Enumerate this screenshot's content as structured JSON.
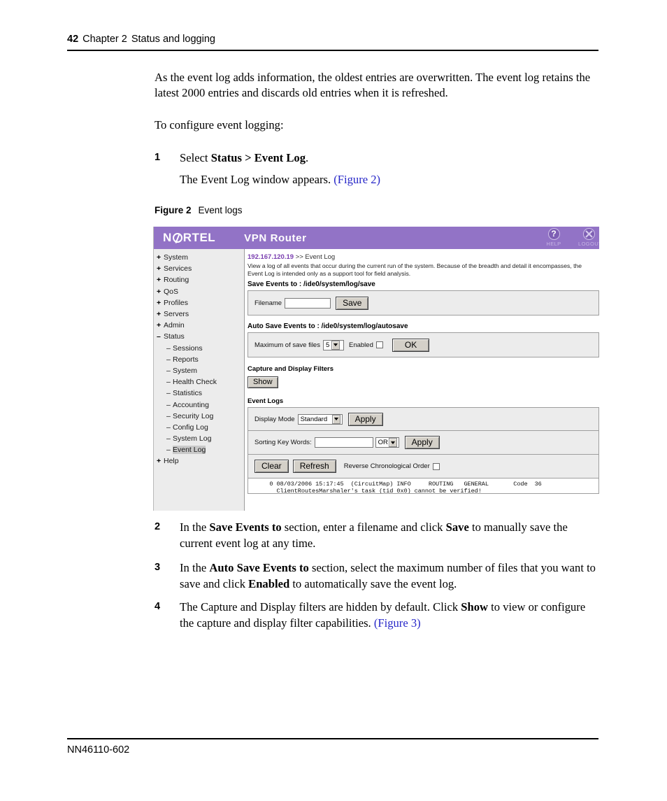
{
  "page": {
    "number": "42",
    "chapter": "Chapter 2",
    "chapter_title": "Status and logging",
    "footer_doc_id": "NN46110-602"
  },
  "paragraphs": {
    "p1": "As the event log adds information, the oldest entries are overwritten. The event log retains the latest 2000 entries and discards old entries when it is refreshed.",
    "p2": "To configure event logging:"
  },
  "steps": [
    {
      "num": "1",
      "text_pre": "Select ",
      "bold": "Status > Event Log",
      "text_post": ".",
      "subtext_pre": "The Event Log window appears. ",
      "sublink": "(Figure 2)"
    },
    {
      "num": "2",
      "text_pre": "In the ",
      "bold": "Save Events to",
      "text_mid": " section, enter a filename and click ",
      "bold2": "Save",
      "text_post": " to manually save the current event log at any time."
    },
    {
      "num": "3",
      "text_pre": "In the ",
      "bold": "Auto Save Events to",
      "text_mid": " section, select the maximum number of files that you want to save and click ",
      "bold2": "Enabled",
      "text_post": " to automatically save the event log."
    },
    {
      "num": "4",
      "text_pre": "The Capture and Display filters are hidden by default. Click ",
      "bold": "Show",
      "text_post": " to view or configure the capture and display filter capabilities. ",
      "link": "(Figure 3)"
    }
  ],
  "figure": {
    "label": "Figure 2",
    "caption": "Event logs"
  },
  "screenshot": {
    "brand": "N",
    "brand_rest": "RTEL",
    "title": "VPN  Router",
    "top_icons": [
      {
        "glyph": "?",
        "caption": "HELP"
      },
      {
        "glyph": "",
        "caption": "LOGOUT"
      }
    ],
    "sidebar": [
      {
        "level": 1,
        "sign": "+",
        "label": "System",
        "selected": false
      },
      {
        "level": 1,
        "sign": "+",
        "label": "Services",
        "selected": false
      },
      {
        "level": 1,
        "sign": "+",
        "label": "Routing",
        "selected": false
      },
      {
        "level": 1,
        "sign": "+",
        "label": "QoS",
        "selected": false
      },
      {
        "level": 1,
        "sign": "+",
        "label": "Profiles",
        "selected": false
      },
      {
        "level": 1,
        "sign": "+",
        "label": "Servers",
        "selected": false
      },
      {
        "level": 1,
        "sign": "+",
        "label": "Admin",
        "selected": false
      },
      {
        "level": 1,
        "sign": "–",
        "label": "Status",
        "selected": false
      },
      {
        "level": 2,
        "sign": "–",
        "label": "Sessions",
        "selected": false
      },
      {
        "level": 2,
        "sign": "–",
        "label": "Reports",
        "selected": false
      },
      {
        "level": 2,
        "sign": "–",
        "label": "System",
        "selected": false
      },
      {
        "level": 2,
        "sign": "–",
        "label": "Health Check",
        "selected": false
      },
      {
        "level": 2,
        "sign": "–",
        "label": "Statistics",
        "selected": false
      },
      {
        "level": 2,
        "sign": "–",
        "label": "Accounting",
        "selected": false
      },
      {
        "level": 2,
        "sign": "–",
        "label": "Security Log",
        "selected": false
      },
      {
        "level": 2,
        "sign": "–",
        "label": "Config Log",
        "selected": false
      },
      {
        "level": 2,
        "sign": "–",
        "label": "System Log",
        "selected": false
      },
      {
        "level": 2,
        "sign": "–",
        "label": "Event Log",
        "selected": true
      },
      {
        "level": 1,
        "sign": "+",
        "label": "Help",
        "selected": false
      }
    ],
    "breadcrumb": {
      "ip": "192.167.120.19",
      "arrows": " >> ",
      "current": "Event Log"
    },
    "description": "View a log of all events that occur during the current run of the system. Because of the breadth and detail it encompasses, the Event Log is intended only as a support tool for field analysis.",
    "save_section": {
      "heading": "Save Events to : /ide0/system/log/save",
      "filename_label": "Filename",
      "filename_value": "",
      "save_button": "Save"
    },
    "autosave_section": {
      "heading": "Auto Save Events to : /ide0/system/log/autosave",
      "max_label": "Maximum of save files",
      "max_value": "5",
      "enabled_label": "Enabled",
      "enabled_checked": false,
      "ok_button": "OK"
    },
    "filters_section": {
      "heading": "Capture and Display Filters",
      "show_button": "Show"
    },
    "event_logs_section": {
      "heading": "Event Logs",
      "display_mode_label": "Display Mode",
      "display_mode_value": "Standard",
      "display_mode_apply": "Apply",
      "sorting_label": "Sorting Key Words:",
      "sorting_value": "",
      "sorting_operator": "OR",
      "sorting_apply": "Apply",
      "clear_button": "Clear",
      "refresh_button": "Refresh",
      "reverse_label": "Reverse Chronological Order",
      "reverse_checked": false,
      "log_line_1": "      0 08/03/2006 15:17:45  (CircuitMap) INFO     ROUTING   GENERAL       Code  36",
      "log_line_2": "        ClientRoutesMarshaler's task (tid 0x0) cannot be verified!"
    }
  },
  "colors": {
    "header_purple": "#9273c6",
    "link_blue": "#2626c8",
    "breadcrumb_purple": "#7a3fb0",
    "panel_gray": "#ececec",
    "button_face": "#d4d0c8"
  }
}
